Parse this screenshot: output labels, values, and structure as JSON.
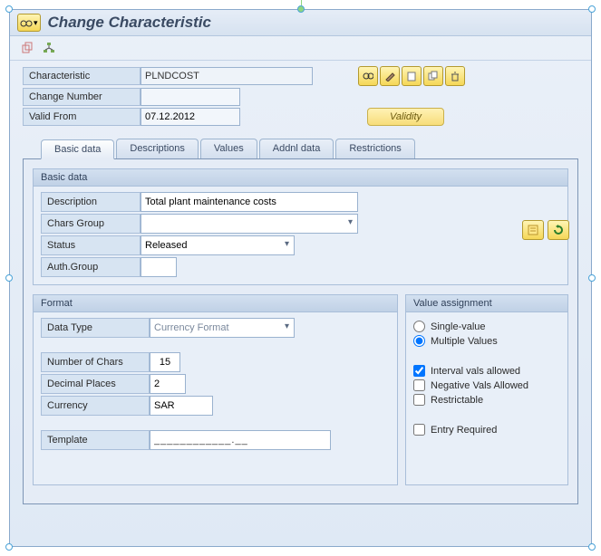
{
  "window": {
    "title": "Change Characteristic"
  },
  "header": {
    "characteristic_label": "Characteristic",
    "characteristic_value": "PLNDCOST",
    "change_number_label": "Change Number",
    "change_number_value": "",
    "valid_from_label": "Valid From",
    "valid_from_value": "07.12.2012",
    "validity_button": "Validity"
  },
  "tabs": {
    "basic": "Basic data",
    "descriptions": "Descriptions",
    "values": "Values",
    "addnl": "Addnl data",
    "restrictions": "Restrictions"
  },
  "basic_group": {
    "title": "Basic data",
    "description_label": "Description",
    "description_value": "Total plant maintenance costs",
    "chars_group_label": "Chars Group",
    "chars_group_value": "",
    "status_label": "Status",
    "status_value": "Released",
    "auth_group_label": "Auth.Group",
    "auth_group_value": ""
  },
  "format_group": {
    "title": "Format",
    "data_type_label": "Data Type",
    "data_type_value": "Currency Format",
    "num_chars_label": "Number of Chars",
    "num_chars_value": "15",
    "decimal_label": "Decimal Places",
    "decimal_value": "2",
    "currency_label": "Currency",
    "currency_value": "SAR",
    "template_label": "Template",
    "template_value": "____________.__"
  },
  "value_assignment": {
    "title": "Value assignment",
    "single_label": "Single-value",
    "multiple_label": "Multiple Values",
    "single_checked": false,
    "multiple_checked": true,
    "interval_label": "Interval vals allowed",
    "interval_checked": true,
    "negative_label": "Negative Vals Allowed",
    "negative_checked": false,
    "restrictable_label": "Restrictable",
    "restrictable_checked": false,
    "entry_required_label": "Entry Required",
    "entry_required_checked": false
  }
}
